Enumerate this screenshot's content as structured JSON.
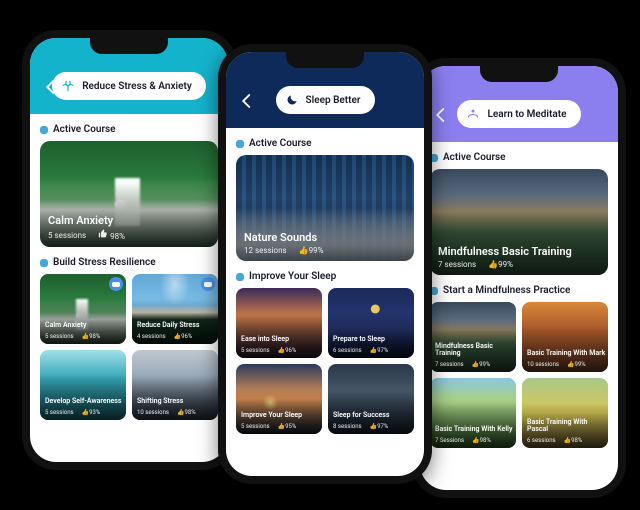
{
  "phones": [
    {
      "header_label": "Reduce Stress & Anxiety",
      "active_section": "Active Course",
      "hero": {
        "title": "Calm Anxiety",
        "sessions": "5 sessions",
        "rating": "98%"
      },
      "second_section": "Build Stress Resilience",
      "cards": [
        {
          "title": "Calm Anxiety",
          "sessions": "5 sessions",
          "rating": "98%",
          "badge": true
        },
        {
          "title": "Reduce Daily Stress",
          "sessions": "4 sessions",
          "rating": "96%",
          "badge": true
        },
        {
          "title": "Develop Self-Awareness",
          "sessions": "5 sessions",
          "rating": "93%"
        },
        {
          "title": "Shifting Stress",
          "sessions": "10 sessions",
          "rating": "98%"
        }
      ]
    },
    {
      "header_label": "Sleep Better",
      "active_section": "Active Course",
      "hero": {
        "title": "Nature Sounds",
        "sessions": "12 sessions",
        "rating": "99%"
      },
      "second_section": "Improve Your Sleep",
      "cards": [
        {
          "title": "Ease into Sleep",
          "sessions": "5 sessions",
          "rating": "96%"
        },
        {
          "title": "Prepare to Sleep",
          "sessions": "6 sessions",
          "rating": "97%"
        },
        {
          "title": "Improve Your Sleep",
          "sessions": "5 sessions",
          "rating": "95%"
        },
        {
          "title": "Sleep for Success",
          "sessions": "8 sessions",
          "rating": "97%"
        }
      ]
    },
    {
      "header_label": "Learn to Meditate",
      "active_section": "Active Course",
      "hero": {
        "title": "Mindfulness Basic Training",
        "sessions": "7 sessions",
        "rating": "99%"
      },
      "second_section": "Start a Mindfulness Practice",
      "cards": [
        {
          "title": "Mindfulness Basic Training",
          "sessions": "7 sessions",
          "rating": "99%"
        },
        {
          "title": "Basic Training With Mark",
          "sessions": "10 sessions",
          "rating": "99%"
        },
        {
          "title": "Basic Training With Kelly",
          "sessions": "7 Sessions",
          "rating": "98%"
        },
        {
          "title": "Basic Training With Pascal",
          "sessions": "6 sessions",
          "rating": "98%"
        }
      ]
    }
  ]
}
